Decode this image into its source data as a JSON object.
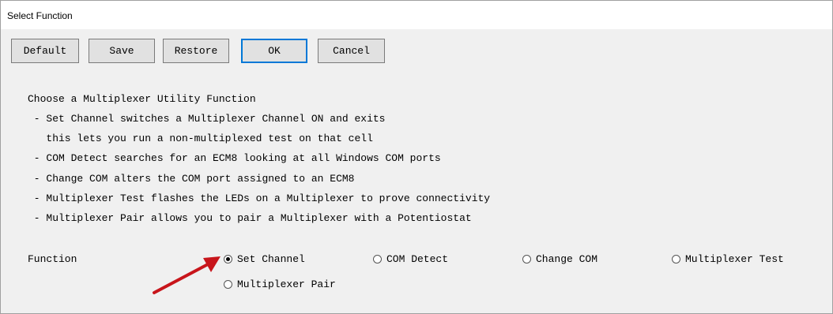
{
  "window": {
    "title": "Select Function"
  },
  "toolbar": {
    "buttons": [
      {
        "label": "Default"
      },
      {
        "label": "Save"
      },
      {
        "label": "Restore"
      },
      {
        "label": "OK"
      },
      {
        "label": "Cancel"
      }
    ]
  },
  "description": {
    "lines": [
      "Choose a Multiplexer Utility Function",
      " - Set Channel switches a Multiplexer Channel ON and exits",
      "   this lets you run a non-multiplexed test on that cell",
      " - COM Detect searches for an ECM8 looking at all Windows COM ports",
      " - Change COM alters the COM port assigned to an ECM8",
      " - Multiplexer Test flashes the LEDs on a Multiplexer to prove connectivity",
      " - Multiplexer Pair allows you to pair a Multiplexer with a Potentiostat"
    ]
  },
  "function": {
    "label": "Function",
    "selected": "Set Channel",
    "options": [
      {
        "label": "Set Channel",
        "checked": true
      },
      {
        "label": "COM Detect",
        "checked": false
      },
      {
        "label": "Change COM",
        "checked": false
      },
      {
        "label": "Multiplexer Test",
        "checked": false
      },
      {
        "label": "Multiplexer Pair",
        "checked": false
      }
    ]
  },
  "annotation": {
    "arrow_color": "#c8151b"
  }
}
